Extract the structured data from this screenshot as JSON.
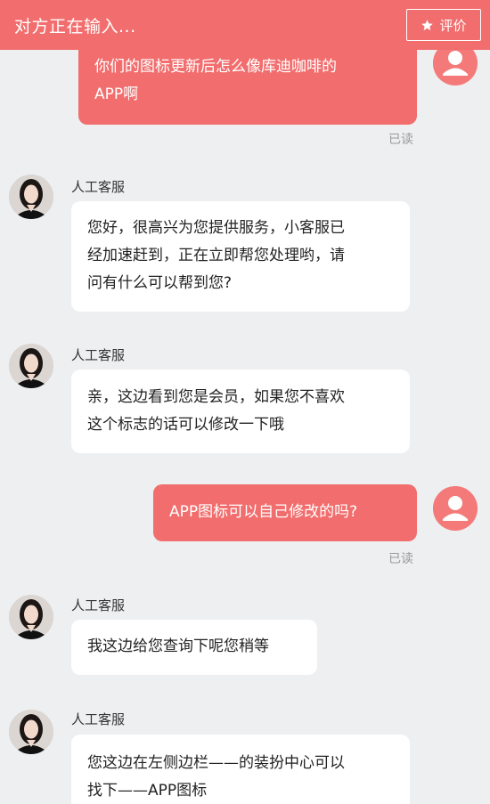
{
  "header": {
    "title": "对方正在输入...",
    "rate_label": "评价",
    "rate_icon": "star-icon"
  },
  "colors": {
    "accent": "#f26d6d",
    "background": "#eeeff1",
    "bubble_in": "#ffffff"
  },
  "messages": [
    {
      "side": "out",
      "lines": [
        "你们的图标更新后怎么像库迪咖啡的",
        "APP啊"
      ],
      "status": "已读"
    },
    {
      "side": "in",
      "sender": "人工客服",
      "lines": [
        "您好，很高兴为您提供服务，小客服已",
        "经加速赶到，正在立即帮您处理哟，请",
        "问有什么可以帮到您?"
      ]
    },
    {
      "side": "in",
      "sender": "人工客服",
      "lines": [
        "亲，这边看到您是会员，如果您不喜欢",
        "这个标志的话可以修改一下哦"
      ]
    },
    {
      "side": "out",
      "lines": [
        "APP图标可以自己修改的吗?"
      ],
      "status": "已读"
    },
    {
      "side": "in",
      "sender": "人工客服",
      "lines": [
        "我这边给您查询下呢您稍等"
      ]
    },
    {
      "side": "in",
      "sender": "人工客服",
      "lines": [
        "您这边在左侧边栏——的装扮中心可以",
        "找下——APP图标"
      ]
    }
  ]
}
